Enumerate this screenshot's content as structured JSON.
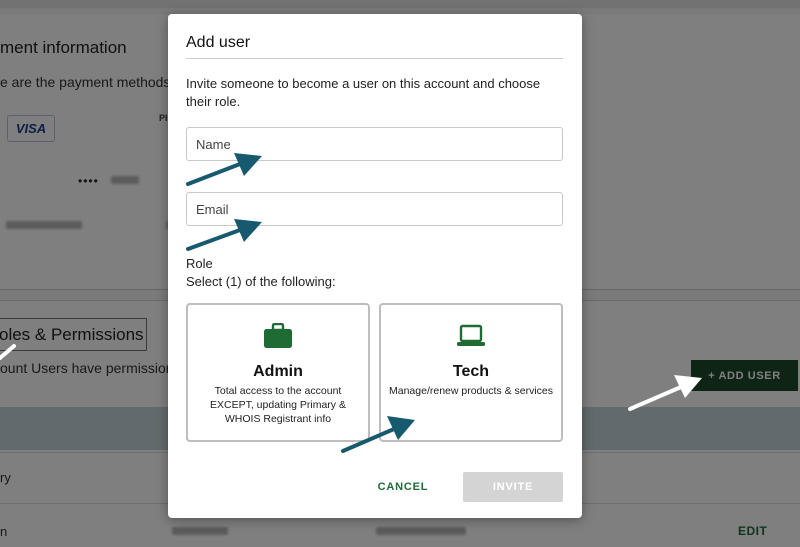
{
  "background": {
    "payment_title": "ment information",
    "payment_description": "e are the payment methods u",
    "card_brand": "VISA",
    "column_hint": "PI",
    "card_mask": "••••",
    "roles_title": "oles & Permissions",
    "roles_description": "ount Users have permission t",
    "add_user_label": "+ ADD USER",
    "row1_text": "ry",
    "row2_text": "n",
    "edit_label": "EDIT"
  },
  "modal": {
    "title": "Add user",
    "intro": "Invite someone to become a user on this account and choose their role.",
    "name_placeholder": "Name",
    "email_placeholder": "Email",
    "role_label": "Role",
    "role_hint": "Select (1) of the following:",
    "roles": [
      {
        "name": "Admin",
        "icon": "briefcase-icon",
        "description": "Total access to the account EXCEPT, updating Primary & WHOIS Registrant info"
      },
      {
        "name": "Tech",
        "icon": "laptop-icon",
        "description": "Manage/renew products & services"
      }
    ],
    "cancel_label": "CANCEL",
    "invite_label": "INVITE"
  },
  "colors": {
    "brand_green": "#1d4a2a",
    "link_green": "#1d6b3a",
    "icon_green": "#1f6b34",
    "annotation_arrow": "#17596e"
  }
}
